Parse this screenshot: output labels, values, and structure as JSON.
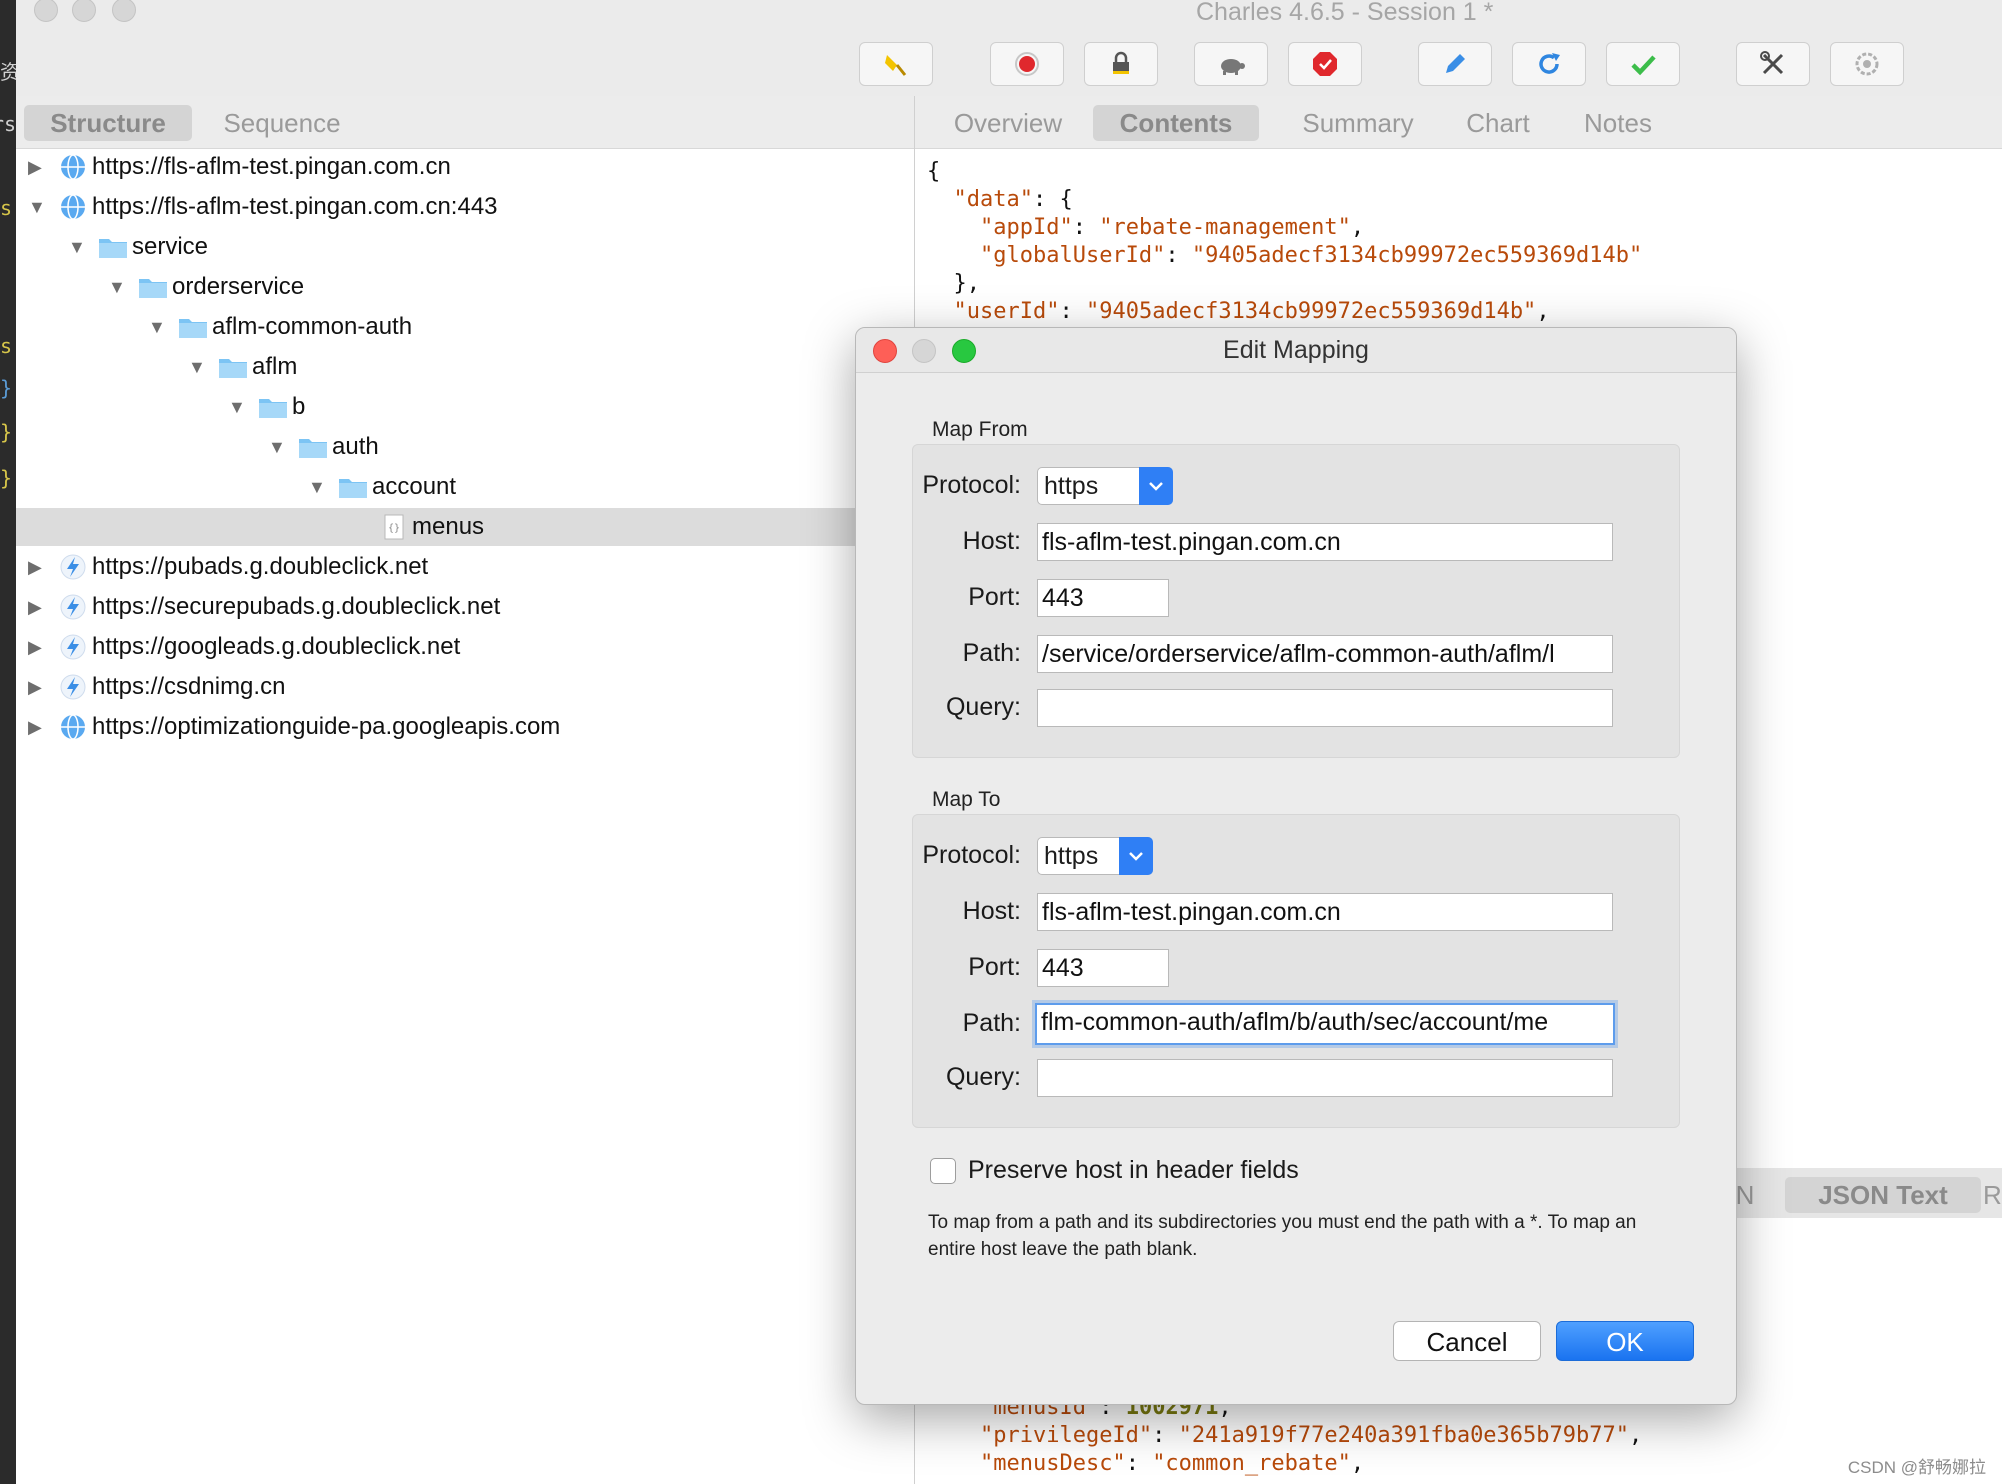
{
  "app": {
    "title": "Charles 4.6.5 - Session 1 *"
  },
  "editor_strip_chars": [
    "资",
    "rs",
    "s",
    "s",
    "}",
    "}",
    "}"
  ],
  "toolbar": {
    "buttons": [
      {
        "name": "broom-icon",
        "color": "#e8b400"
      },
      {
        "name": "record-icon",
        "color": "#e0282d"
      },
      {
        "name": "lock-icon",
        "color": "#555555"
      },
      {
        "name": "turtle-icon",
        "color": "#777777"
      },
      {
        "name": "stop-icon",
        "color": "#e0282d"
      },
      {
        "name": "pen-icon",
        "color": "#3a8ee6"
      },
      {
        "name": "refresh-icon",
        "color": "#2f86e0"
      },
      {
        "name": "check-icon",
        "color": "#3cbd4a"
      },
      {
        "name": "tools-icon",
        "color": "#4a4a4a"
      },
      {
        "name": "settings-icon",
        "color": "#9a9a9a"
      }
    ]
  },
  "left_tabs": {
    "structure": "Structure",
    "sequence": "Sequence"
  },
  "right_tabs": {
    "overview": "Overview",
    "contents": "Contents",
    "summary": "Summary",
    "chart": "Chart",
    "notes": "Notes"
  },
  "tree": [
    {
      "label": "https://fls-aflm-test.pingan.com.cn",
      "icon": "globe-icon",
      "expanded": false
    },
    {
      "label": "https://fls-aflm-test.pingan.com.cn:443",
      "icon": "globe-icon",
      "expanded": true
    },
    {
      "label": "service",
      "icon": "folder-icon",
      "expanded": true
    },
    {
      "label": "orderservice",
      "icon": "folder-icon",
      "expanded": true
    },
    {
      "label": "aflm-common-auth",
      "icon": "folder-icon",
      "expanded": true
    },
    {
      "label": "aflm",
      "icon": "folder-icon",
      "expanded": true
    },
    {
      "label": "b",
      "icon": "folder-icon",
      "expanded": true
    },
    {
      "label": "auth",
      "icon": "folder-icon",
      "expanded": true
    },
    {
      "label": "account",
      "icon": "folder-icon",
      "expanded": true
    },
    {
      "label": "menus",
      "icon": "json-file-icon",
      "selected": true
    },
    {
      "label": "https://pubads.g.doubleclick.net",
      "icon": "lightning-icon",
      "expanded": false
    },
    {
      "label": "https://securepubads.g.doubleclick.net",
      "icon": "lightning-icon",
      "expanded": false
    },
    {
      "label": "https://googleads.g.doubleclick.net",
      "icon": "lightning-icon",
      "expanded": false
    },
    {
      "label": "https://csdnimg.cn",
      "icon": "lightning-icon",
      "expanded": false
    },
    {
      "label": "https://optimizationguide-pa.googleapis.com",
      "icon": "globe-icon",
      "expanded": false
    }
  ],
  "json_content": {
    "brace_open": "{",
    "data_key": "\"data\"",
    "appId_key": "\"appId\"",
    "appId_val": "\"rebate-management\"",
    "globalUserId_key": "\"globalUserId\"",
    "globalUserId_val": "\"9405adecf3134cb99972ec559369d14b\"",
    "close_obj": "},",
    "userId_key": "\"userId\"",
    "userId_val": "\"9405adecf3134cb99972ec559369d14b\"",
    "menusId_key": "\"menusId\"",
    "menusId_val": "1002971",
    "privilegeId_key": "\"privilegeId\"",
    "privilegeId_val": "\"241a919f77e240a391fba0e365b79b77\"",
    "menusDesc_key": "\"menusDesc\"",
    "menusDesc_val": "\"common_rebate\""
  },
  "lower_tabs": {
    "partial_left": "N",
    "json_text": "JSON Text",
    "partial_right": "R"
  },
  "dialog": {
    "title": "Edit Mapping",
    "map_from": {
      "title": "Map From",
      "protocol_label": "Protocol:",
      "protocol": "https",
      "host_label": "Host:",
      "host": "fls-aflm-test.pingan.com.cn",
      "port_label": "Port:",
      "port": "443",
      "path_label": "Path:",
      "path": "/service/orderservice/aflm-common-auth/aflm/l",
      "query_label": "Query:",
      "query": ""
    },
    "map_to": {
      "title": "Map To",
      "protocol_label": "Protocol:",
      "protocol": "https",
      "host_label": "Host:",
      "host": "fls-aflm-test.pingan.com.cn",
      "port_label": "Port:",
      "port": "443",
      "path_label": "Path:",
      "path": "flm-common-auth/aflm/b/auth/sec/account/me",
      "query_label": "Query:",
      "query": ""
    },
    "preserve_host_label": "Preserve host in header fields",
    "preserve_host_checked": false,
    "help_text": "To map from a path and its subdirectories you must end the path with a *. To map an entire host leave the path blank.",
    "cancel_label": "Cancel",
    "ok_label": "OK"
  },
  "watermark": "CSDN @舒畅娜拉"
}
